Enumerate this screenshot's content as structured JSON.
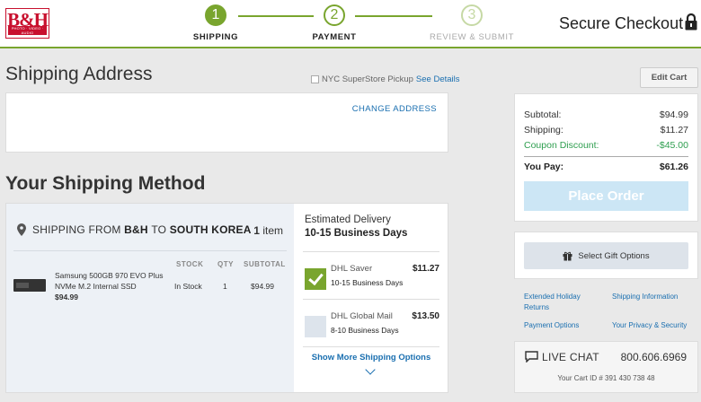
{
  "brand": {
    "logo_text": "B&H",
    "logo_tagline": "PHOTO · VIDEO · AUDIO"
  },
  "steps": [
    {
      "number": "1",
      "label": "SHIPPING",
      "state": "complete"
    },
    {
      "number": "2",
      "label": "PAYMENT",
      "state": "current"
    },
    {
      "number": "3",
      "label": "REVIEW & SUBMIT",
      "state": "upcoming"
    }
  ],
  "header": {
    "secure_title": "Secure Checkout"
  },
  "shipping_address": {
    "heading": "Shipping Address",
    "pickup_label": "NYC SuperStore Pickup",
    "pickup_checked": false,
    "see_details": "See Details",
    "change_address": "CHANGE ADDRESS"
  },
  "shipping_method": {
    "heading": "Your Shipping Method",
    "from_prefix": "SHIPPING FROM",
    "from": "B&H",
    "to_prefix": "TO",
    "to": "SOUTH KOREA",
    "item_count": "1",
    "item_word": "item",
    "columns": {
      "stock": "STOCK",
      "qty": "QTY",
      "subtotal": "SUBTOTAL"
    },
    "product": {
      "name": "Samsung 500GB 970 EVO Plus NVMe M.2 Internal SSD",
      "price": "$94.99",
      "stock": "In Stock",
      "qty": "1",
      "subtotal": "$94.99"
    },
    "estimated_label": "Estimated Delivery",
    "estimated_value": "10-15 Business Days",
    "options": [
      {
        "name": "DHL Saver",
        "days": "10-15 Business Days",
        "price": "$11.27",
        "selected": true
      },
      {
        "name": "DHL Global Mail",
        "days": "8-10 Business Days",
        "price": "$13.50",
        "selected": false
      }
    ],
    "show_more": "Show More Shipping Options"
  },
  "summary": {
    "edit_cart": "Edit Cart",
    "subtotal_label": "Subtotal:",
    "subtotal": "$94.99",
    "shipping_label": "Shipping:",
    "shipping": "$11.27",
    "coupon_label": "Coupon Discount:",
    "coupon": "-$45.00",
    "you_pay_label": "You Pay:",
    "you_pay": "$61.26",
    "place_order": "Place Order"
  },
  "gift": {
    "label": "Select Gift Options"
  },
  "links": {
    "holiday_returns": "Extended Holiday Returns",
    "shipping_info": "Shipping Information",
    "payment_options": "Payment Options",
    "privacy": "Your Privacy & Security"
  },
  "chat": {
    "label": "LIVE CHAT",
    "phone": "800.606.6969",
    "cart_id": "Your Cart ID # 391 430 738 48"
  },
  "colors": {
    "accent_green": "#79a52e",
    "link_blue": "#1a6fb0",
    "discount_green": "#2e9e4f",
    "place_order_disabled": "#cce6f5"
  }
}
